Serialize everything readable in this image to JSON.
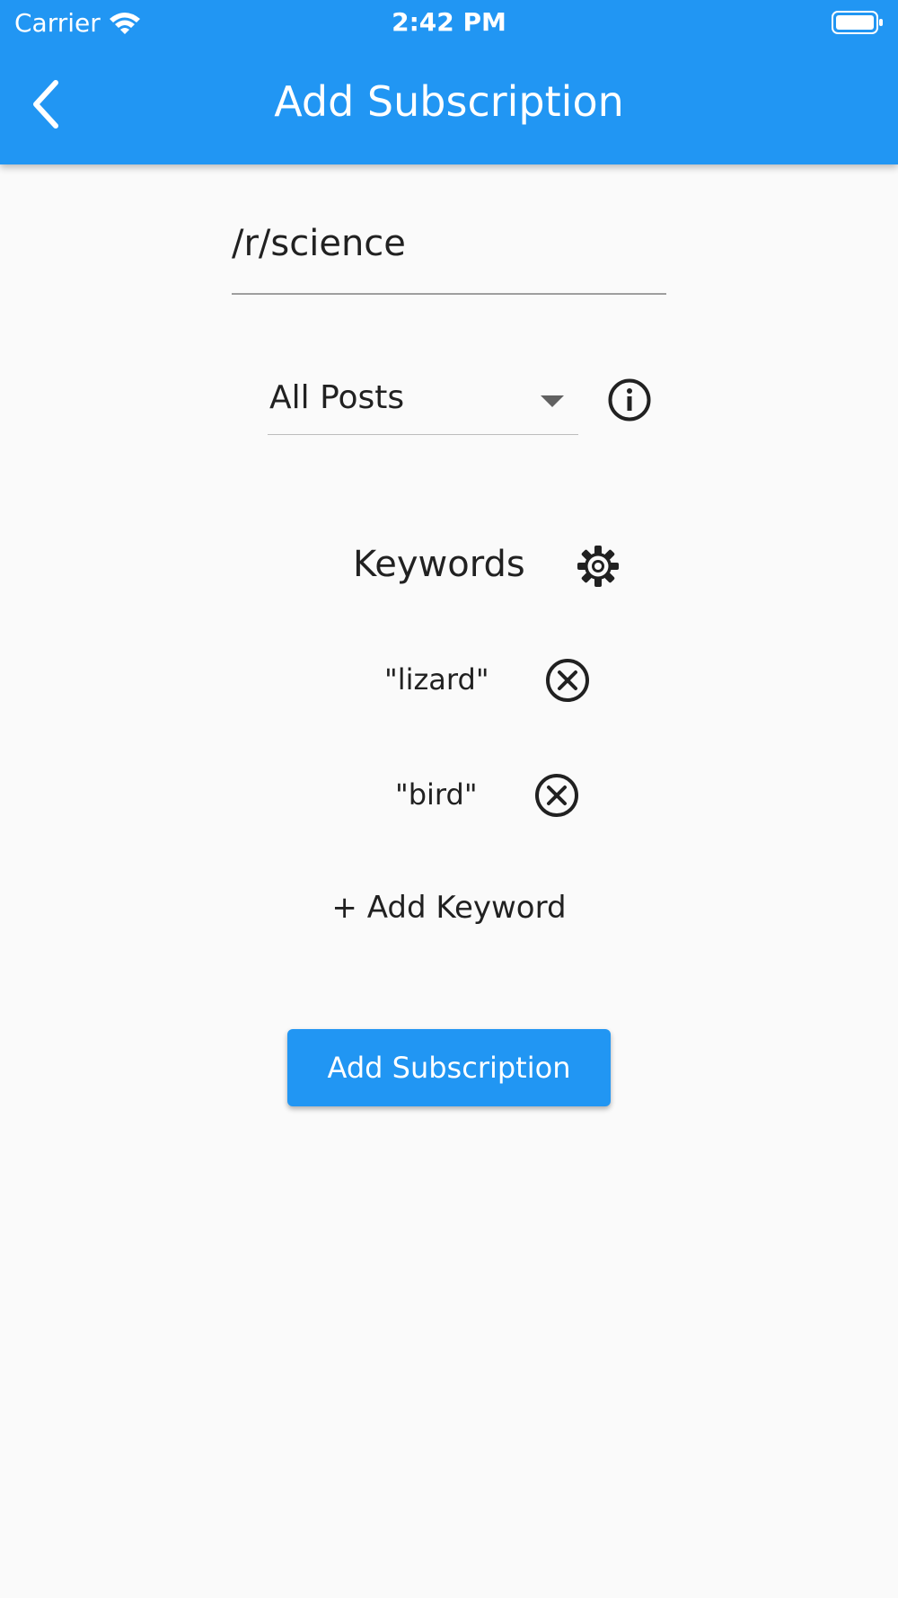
{
  "status_bar": {
    "carrier": "Carrier",
    "time": "2:42 PM",
    "wifi_icon": "wifi-icon",
    "battery_icon": "battery-full-icon"
  },
  "app_bar": {
    "title": "Add Subscription",
    "back_icon": "chevron-left-icon",
    "color": "#2196f3"
  },
  "form": {
    "subreddit_value": "/r/science",
    "post_filter": {
      "selected": "All Posts",
      "info_icon": "info-icon"
    },
    "keywords": {
      "label": "Keywords",
      "settings_icon": "gear-icon",
      "items": [
        {
          "label": "\"lizard\"",
          "remove_icon": "close-circle-icon"
        },
        {
          "label": "\"bird\"",
          "remove_icon": "close-circle-icon"
        }
      ],
      "add_label": "+ Add Keyword"
    },
    "submit_label": "Add Subscription"
  }
}
